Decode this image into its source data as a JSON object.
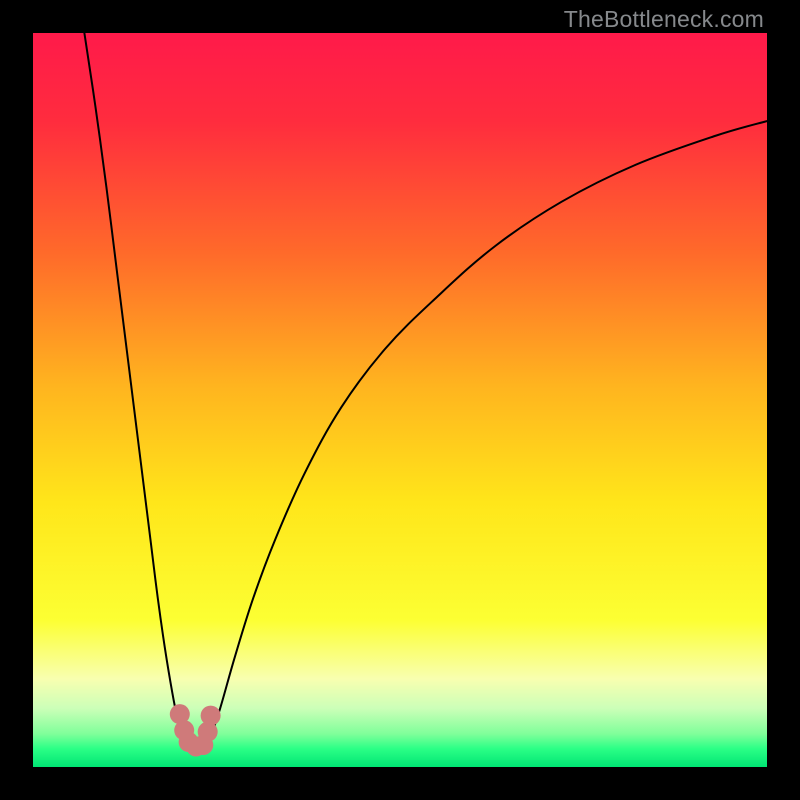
{
  "watermark": {
    "text": "TheBottleneck.com"
  },
  "chart_data": {
    "type": "line",
    "title": "",
    "xlabel": "",
    "ylabel": "",
    "xlim": [
      0,
      100
    ],
    "ylim": [
      0,
      100
    ],
    "legend": false,
    "grid": false,
    "background_gradient": {
      "type": "vertical",
      "stops": [
        {
          "pos": 0.0,
          "color": "#ff1a4a"
        },
        {
          "pos": 0.12,
          "color": "#ff2c3e"
        },
        {
          "pos": 0.3,
          "color": "#ff6a2a"
        },
        {
          "pos": 0.48,
          "color": "#ffb41f"
        },
        {
          "pos": 0.64,
          "color": "#ffe61a"
        },
        {
          "pos": 0.8,
          "color": "#fcff33"
        },
        {
          "pos": 0.88,
          "color": "#f8ffb0"
        },
        {
          "pos": 0.92,
          "color": "#ccffb8"
        },
        {
          "pos": 0.955,
          "color": "#7fff9a"
        },
        {
          "pos": 0.975,
          "color": "#2bff86"
        },
        {
          "pos": 1.0,
          "color": "#00e574"
        }
      ]
    },
    "series": [
      {
        "name": "left-branch",
        "stroke": "#000000",
        "stroke_width": 2,
        "x": [
          7.0,
          8.5,
          10.0,
          11.5,
          13.0,
          14.5,
          16.0,
          17.0,
          18.0,
          19.0,
          19.6,
          20.2,
          20.8
        ],
        "y": [
          100,
          90,
          79,
          67,
          55,
          43,
          31,
          23,
          16,
          10,
          7,
          5,
          3.5
        ]
      },
      {
        "name": "right-branch",
        "stroke": "#000000",
        "stroke_width": 2,
        "x": [
          24.0,
          25.5,
          27.5,
          30.0,
          33.0,
          37.0,
          42.0,
          48.0,
          55.0,
          63.0,
          72.0,
          82.0,
          93.0,
          100.0
        ],
        "y": [
          3.5,
          8,
          15,
          23,
          31,
          40,
          49,
          57,
          64,
          71,
          77,
          82,
          86,
          88
        ]
      },
      {
        "name": "valley-floor",
        "stroke": "#000000",
        "stroke_width": 2,
        "x": [
          20.8,
          21.5,
          22.2,
          23.0,
          23.5,
          24.0
        ],
        "y": [
          3.5,
          2.8,
          2.6,
          2.7,
          3.0,
          3.5
        ]
      }
    ],
    "markers": [
      {
        "name": "valley-markers",
        "color": "#cf7a7a",
        "radius": 10,
        "points": [
          {
            "x": 20.0,
            "y": 7.2
          },
          {
            "x": 20.6,
            "y": 5.0
          },
          {
            "x": 21.2,
            "y": 3.4
          },
          {
            "x": 22.2,
            "y": 2.8
          },
          {
            "x": 23.2,
            "y": 3.0
          },
          {
            "x": 23.8,
            "y": 4.8
          },
          {
            "x": 24.2,
            "y": 7.0
          }
        ]
      }
    ]
  }
}
